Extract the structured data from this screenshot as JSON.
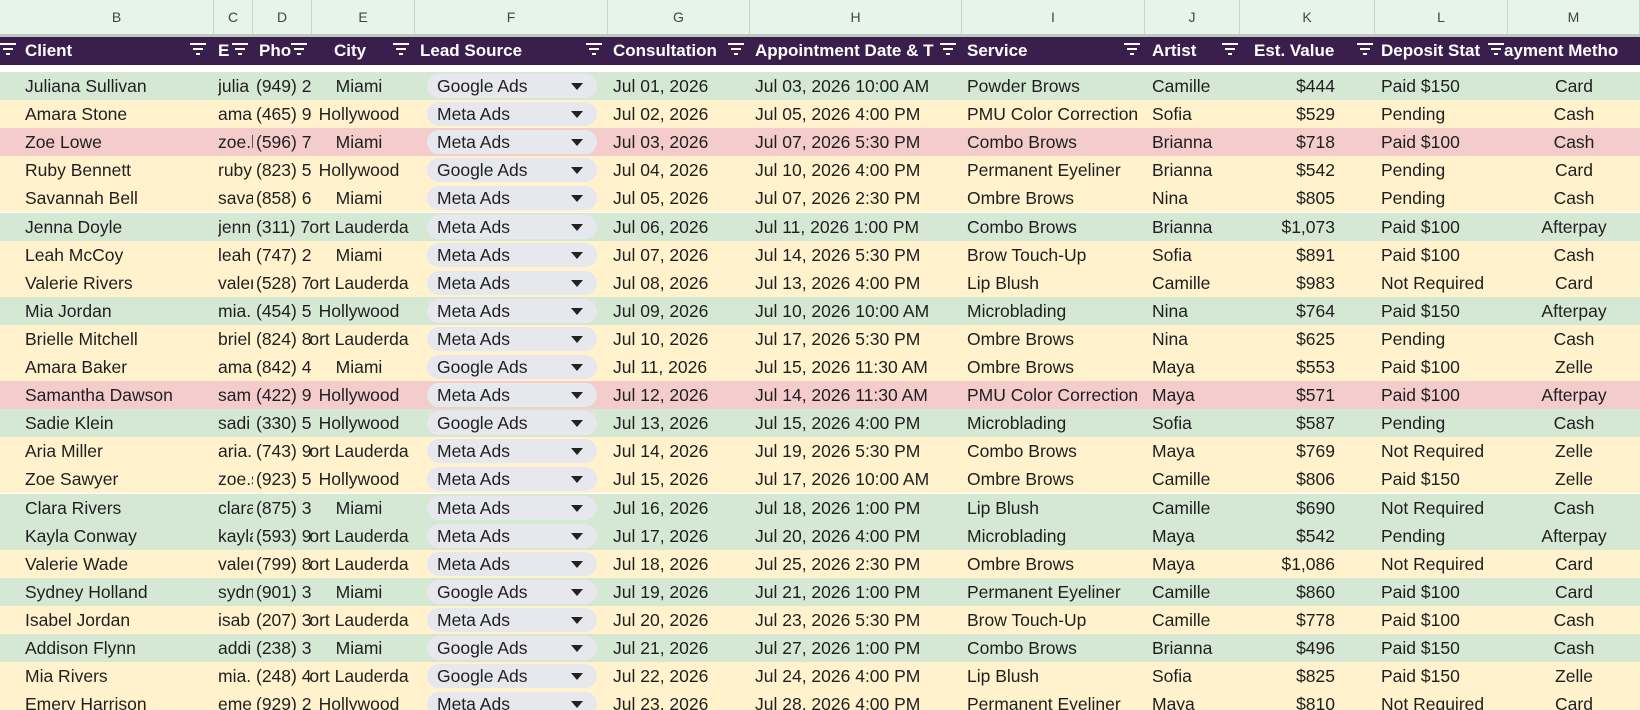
{
  "column_letters": [
    "B",
    "C",
    "D",
    "E",
    "F",
    "G",
    "H",
    "I",
    "J",
    "K",
    "L",
    "M"
  ],
  "headers": [
    "Client",
    "E",
    "Pho",
    "City",
    "Lead Source",
    "Consultation",
    "Appointment Date & T",
    "Service",
    "Artist",
    "Est. Value",
    "Deposit Stat",
    "ayment Metho"
  ],
  "rows": [
    {
      "client": "Juliana Sullivan",
      "email": "julia",
      "phone": "(949) 2",
      "city": "Miami",
      "source": "Google Ads",
      "consult": "Jul 01, 2026",
      "appt": "Jul 03, 2026 10:00 AM",
      "service": "Powder Brows",
      "artist": "Camille",
      "value": "$444",
      "deposit": "Paid $150",
      "payment": "Card",
      "color": "green"
    },
    {
      "client": "Amara Stone",
      "email": "ama",
      "phone": "(465) 9",
      "city": "Hollywood",
      "source": "Meta Ads",
      "consult": "Jul 02, 2026",
      "appt": "Jul 05, 2026 4:00 PM",
      "service": "PMU Color Correction",
      "artist": "Sofia",
      "value": "$529",
      "deposit": "Pending",
      "payment": "Cash",
      "color": "yellow"
    },
    {
      "client": "Zoe Lowe",
      "email": "zoe.l",
      "phone": "(596) 7",
      "city": "Miami",
      "source": "Meta Ads",
      "consult": "Jul 03, 2026",
      "appt": "Jul 07, 2026 5:30 PM",
      "service": "Combo Brows",
      "artist": "Brianna",
      "value": "$718",
      "deposit": "Paid $100",
      "payment": "Cash",
      "color": "pink"
    },
    {
      "client": "Ruby Bennett",
      "email": "ruby",
      "phone": "(823) 5",
      "city": "Hollywood",
      "source": "Google Ads",
      "consult": "Jul 04, 2026",
      "appt": "Jul 10, 2026 4:00 PM",
      "service": "Permanent Eyeliner",
      "artist": "Brianna",
      "value": "$542",
      "deposit": "Pending",
      "payment": "Card",
      "color": "yellow"
    },
    {
      "client": "Savannah Bell",
      "email": "sava",
      "phone": "(858) 6",
      "city": "Miami",
      "source": "Meta Ads",
      "consult": "Jul 05, 2026",
      "appt": "Jul 07, 2026 2:30 PM",
      "service": "Ombre Brows",
      "artist": "Nina",
      "value": "$805",
      "deposit": "Pending",
      "payment": "Cash",
      "color": "yellow"
    },
    {
      "client": "Jenna Doyle",
      "email": "jenn",
      "phone": "(311) 7",
      "city": "ort Lauderda",
      "source": "Meta Ads",
      "consult": "Jul 06, 2026",
      "appt": "Jul 11, 2026 1:00 PM",
      "service": "Combo Brows",
      "artist": "Brianna",
      "value": "$1,073",
      "deposit": "Paid $100",
      "payment": "Afterpay",
      "color": "green"
    },
    {
      "client": "Leah McCoy",
      "email": "leah",
      "phone": "(747) 2",
      "city": "Miami",
      "source": "Meta Ads",
      "consult": "Jul 07, 2026",
      "appt": "Jul 14, 2026 5:30 PM",
      "service": "Brow Touch-Up",
      "artist": "Sofia",
      "value": "$891",
      "deposit": "Paid $100",
      "payment": "Cash",
      "color": "yellow"
    },
    {
      "client": "Valerie Rivers",
      "email": "valer",
      "phone": "(528) 7",
      "city": "ort Lauderda",
      "source": "Meta Ads",
      "consult": "Jul 08, 2026",
      "appt": "Jul 13, 2026 4:00 PM",
      "service": "Lip Blush",
      "artist": "Camille",
      "value": "$983",
      "deposit": "Not Required",
      "payment": "Card",
      "color": "yellow"
    },
    {
      "client": "Mia Jordan",
      "email": "mia.",
      "phone": "(454) 5",
      "city": "Hollywood",
      "source": "Meta Ads",
      "consult": "Jul 09, 2026",
      "appt": "Jul 10, 2026 10:00 AM",
      "service": "Microblading",
      "artist": "Nina",
      "value": "$764",
      "deposit": "Paid $150",
      "payment": "Afterpay",
      "color": "green"
    },
    {
      "client": "Brielle Mitchell",
      "email": "briel",
      "phone": "(824) 8",
      "city": "ort Lauderda",
      "source": "Meta Ads",
      "consult": "Jul 10, 2026",
      "appt": "Jul 17, 2026 5:30 PM",
      "service": "Ombre Brows",
      "artist": "Nina",
      "value": "$625",
      "deposit": "Pending",
      "payment": "Cash",
      "color": "yellow"
    },
    {
      "client": "Amara Baker",
      "email": "ama",
      "phone": "(842) 4",
      "city": "Miami",
      "source": "Google Ads",
      "consult": "Jul 11, 2026",
      "appt": "Jul 15, 2026 11:30 AM",
      "service": "Ombre Brows",
      "artist": "Maya",
      "value": "$553",
      "deposit": "Paid $100",
      "payment": "Zelle",
      "color": "yellow"
    },
    {
      "client": "Samantha Dawson",
      "email": "sam",
      "phone": "(422) 9",
      "city": "Hollywood",
      "source": "Meta Ads",
      "consult": "Jul 12, 2026",
      "appt": "Jul 14, 2026 11:30 AM",
      "service": "PMU Color Correction",
      "artist": "Maya",
      "value": "$571",
      "deposit": "Paid $100",
      "payment": "Afterpay",
      "color": "pink"
    },
    {
      "client": "Sadie Klein",
      "email": "sadi",
      "phone": "(330) 5",
      "city": "Hollywood",
      "source": "Google Ads",
      "consult": "Jul 13, 2026",
      "appt": "Jul 15, 2026 4:00 PM",
      "service": "Microblading",
      "artist": "Sofia",
      "value": "$587",
      "deposit": "Pending",
      "payment": "Cash",
      "color": "green"
    },
    {
      "client": "Aria Miller",
      "email": "aria.",
      "phone": "(743) 9",
      "city": "ort Lauderda",
      "source": "Meta Ads",
      "consult": "Jul 14, 2026",
      "appt": "Jul 19, 2026 5:30 PM",
      "service": "Combo Brows",
      "artist": "Maya",
      "value": "$769",
      "deposit": "Not Required",
      "payment": "Zelle",
      "color": "yellow"
    },
    {
      "client": "Zoe Sawyer",
      "email": "zoe.s",
      "phone": "(923) 5",
      "city": "Hollywood",
      "source": "Meta Ads",
      "consult": "Jul 15, 2026",
      "appt": "Jul 17, 2026 10:00 AM",
      "service": "Ombre Brows",
      "artist": "Camille",
      "value": "$806",
      "deposit": "Paid $150",
      "payment": "Zelle",
      "color": "yellow"
    },
    {
      "client": "Clara Rivers",
      "email": "clara",
      "phone": "(875) 3",
      "city": "Miami",
      "source": "Meta Ads",
      "consult": "Jul 16, 2026",
      "appt": "Jul 18, 2026 1:00 PM",
      "service": "Lip Blush",
      "artist": "Camille",
      "value": "$690",
      "deposit": "Not Required",
      "payment": "Cash",
      "color": "green"
    },
    {
      "client": "Kayla Conway",
      "email": "kayla",
      "phone": "(593) 9",
      "city": "ort Lauderda",
      "source": "Meta Ads",
      "consult": "Jul 17, 2026",
      "appt": "Jul 20, 2026 4:00 PM",
      "service": "Microblading",
      "artist": "Maya",
      "value": "$542",
      "deposit": "Pending",
      "payment": "Afterpay",
      "color": "green"
    },
    {
      "client": "Valerie Wade",
      "email": "valer",
      "phone": "(799) 8",
      "city": "ort Lauderda",
      "source": "Meta Ads",
      "consult": "Jul 18, 2026",
      "appt": "Jul 25, 2026 2:30 PM",
      "service": "Ombre Brows",
      "artist": "Maya",
      "value": "$1,086",
      "deposit": "Not Required",
      "payment": "Card",
      "color": "yellow"
    },
    {
      "client": "Sydney Holland",
      "email": "sydn",
      "phone": "(901) 3",
      "city": "Miami",
      "source": "Google Ads",
      "consult": "Jul 19, 2026",
      "appt": "Jul 21, 2026 1:00 PM",
      "service": "Permanent Eyeliner",
      "artist": "Camille",
      "value": "$860",
      "deposit": "Paid $100",
      "payment": "Card",
      "color": "green"
    },
    {
      "client": "Isabel Jordan",
      "email": "isab",
      "phone": "(207) 3",
      "city": "ort Lauderda",
      "source": "Meta Ads",
      "consult": "Jul 20, 2026",
      "appt": "Jul 23, 2026 5:30 PM",
      "service": "Brow Touch-Up",
      "artist": "Camille",
      "value": "$778",
      "deposit": "Paid $100",
      "payment": "Cash",
      "color": "yellow"
    },
    {
      "client": "Addison Flynn",
      "email": "addi",
      "phone": "(238) 3",
      "city": "Miami",
      "source": "Google Ads",
      "consult": "Jul 21, 2026",
      "appt": "Jul 27, 2026 1:00 PM",
      "service": "Combo Brows",
      "artist": "Brianna",
      "value": "$496",
      "deposit": "Paid $150",
      "payment": "Cash",
      "color": "green"
    },
    {
      "client": "Mia Rivers",
      "email": "mia.",
      "phone": "(248) 4",
      "city": "ort Lauderda",
      "source": "Google Ads",
      "consult": "Jul 22, 2026",
      "appt": "Jul 24, 2026 4:00 PM",
      "service": "Lip Blush",
      "artist": "Sofia",
      "value": "$825",
      "deposit": "Paid $150",
      "payment": "Zelle",
      "color": "yellow"
    },
    {
      "client": "Emery Harrison",
      "email": "eme",
      "phone": "(929) 2",
      "city": "Hollywood",
      "source": "Meta Ads",
      "consult": "Jul 23, 2026",
      "appt": "Jul 28, 2026 4:00 PM",
      "service": "Permanent Eyeliner",
      "artist": "Maya",
      "value": "$810",
      "deposit": "Not Required",
      "payment": "Card",
      "color": "yellow"
    }
  ],
  "colors": {
    "header_bg": "#3a1e4c",
    "green": "#d5e8d4",
    "yellow": "#fff2cc",
    "pink": "#f4cccc",
    "chip": "#e7e8ee"
  }
}
